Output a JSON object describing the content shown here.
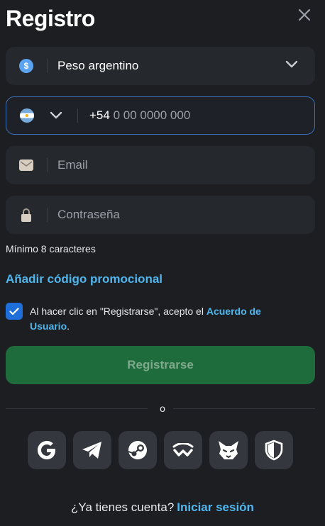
{
  "header": {
    "title": "Registro"
  },
  "currency": {
    "symbol": "$",
    "value": "Peso argentino"
  },
  "phone": {
    "code": "+54",
    "placeholder": "0 00 0000 000"
  },
  "email": {
    "placeholder": "Email"
  },
  "password": {
    "placeholder": "Contraseña",
    "hint": "Mínimo 8 caracteres"
  },
  "promo": {
    "label": "Añadir código promocional"
  },
  "terms": {
    "checked": true,
    "prefix": "Al hacer clic en \"Registrarse\", acepto el ",
    "link": "Acuerdo de Usuario",
    "suffix": "."
  },
  "register": {
    "label": "Registrarse"
  },
  "divider": {
    "label": "o"
  },
  "socials": [
    "google-icon",
    "telegram-icon",
    "steam-icon",
    "walletconnect-icon",
    "metamask-icon",
    "shield-icon"
  ],
  "login": {
    "prompt": "¿Ya tienes cuenta?",
    "link": "Iniciar sesión"
  },
  "colors": {
    "accent": "#4fb6ee",
    "button": "#1e6b3c",
    "checkbox": "#1e6fd9"
  }
}
